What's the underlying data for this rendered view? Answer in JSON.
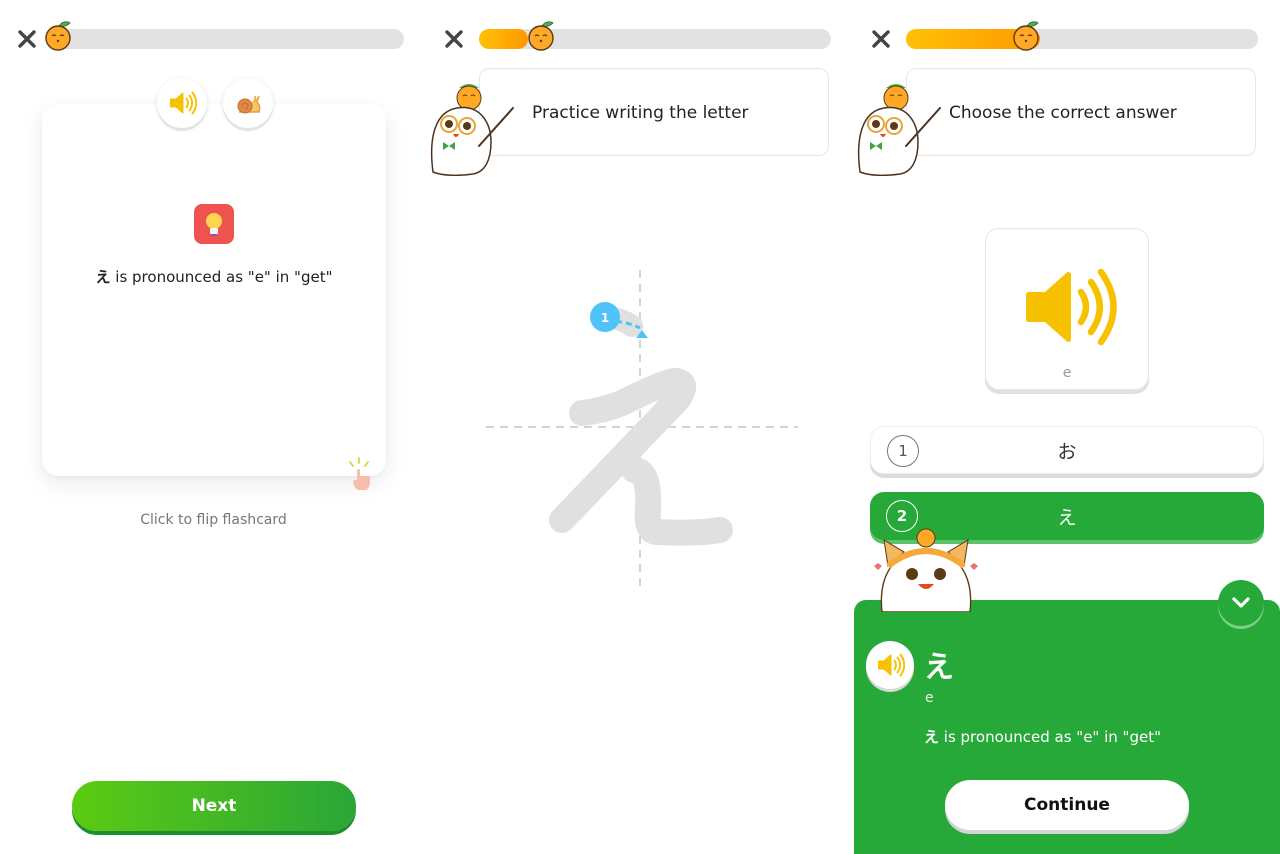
{
  "screens": [
    {
      "id": "flashcard",
      "progress": 0.0,
      "audio_buttons": [
        {
          "icon": "speaker-icon",
          "label": "Play audio"
        },
        {
          "icon": "snail-icon",
          "label": "Play slow audio"
        }
      ],
      "tip_icon": "lightbulb-icon",
      "tip_char": "え",
      "tip_text": " is pronounced as \"e\" in \"get\"",
      "flip_hint": "Click to flip flashcard",
      "next_label": "Next"
    },
    {
      "id": "writing",
      "progress": 0.14,
      "instruction": "Practice writing the letter",
      "stroke_number": "1",
      "character": "え"
    },
    {
      "id": "choice",
      "progress": 0.38,
      "instruction": "Choose the correct answer",
      "sound_card_label": "e",
      "options": [
        {
          "number": "1",
          "text": "お",
          "state": "default"
        },
        {
          "number": "2",
          "text": "え",
          "state": "correct"
        }
      ],
      "result": {
        "character": "え",
        "romaji": "e",
        "desc_char": "え",
        "desc_text": " is pronounced as \"e\" in \"get\"",
        "continue_label": "Continue"
      }
    }
  ],
  "colors": {
    "accent_green": "#27a93a",
    "progress_orange": "#ff9800",
    "speaker_yellow": "#f6c200",
    "stroke_hint_blue": "#4fc3f7",
    "tip_red": "#ef5350"
  }
}
